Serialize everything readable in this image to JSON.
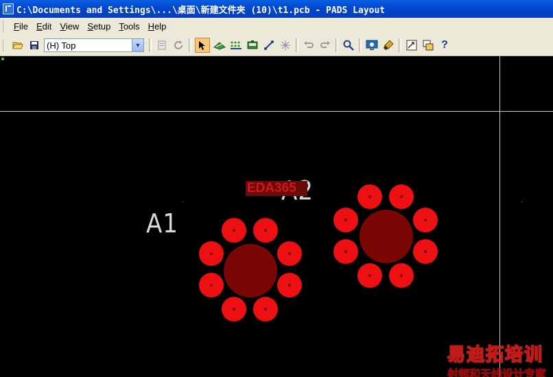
{
  "window": {
    "title": "C:\\Documents and Settings\\...\\桌面\\新建文件夹 (10)\\t1.pcb - PADS Layout"
  },
  "menu": {
    "items": [
      {
        "label_ul": "F",
        "label_rest": "ile"
      },
      {
        "label_ul": "E",
        "label_rest": "dit"
      },
      {
        "label_ul": "V",
        "label_rest": "iew"
      },
      {
        "label_ul": "S",
        "label_rest": "etup"
      },
      {
        "label_ul": "T",
        "label_rest": "ools"
      },
      {
        "label_ul": "H",
        "label_rest": "elp"
      }
    ]
  },
  "toolbar": {
    "layer_select": "(H) Top",
    "icons": [
      "open-icon",
      "save-icon",
      "properties-icon",
      "refresh-icon",
      "select-arrow-icon",
      "design-toolbar-icon",
      "ecp-icon",
      "drafting-icon",
      "route-icon",
      "bga-icon",
      "undo-icon",
      "redo-icon",
      "zoom-icon",
      "view-nets-icon",
      "clean-icon",
      "layout-icon",
      "window-icon",
      "help-icon"
    ]
  },
  "canvas": {
    "ref_a1": "A1",
    "ref_a2": "A2",
    "overlay_mark": "EDA365",
    "watermark_line1": "易迪拓培训",
    "watermark_line2": "射频和天线设计专家",
    "colors": {
      "pad": "#ee0f12",
      "center_pad": "#7a0606",
      "board_line": "#c8c8c8",
      "background": "#000000"
    }
  }
}
